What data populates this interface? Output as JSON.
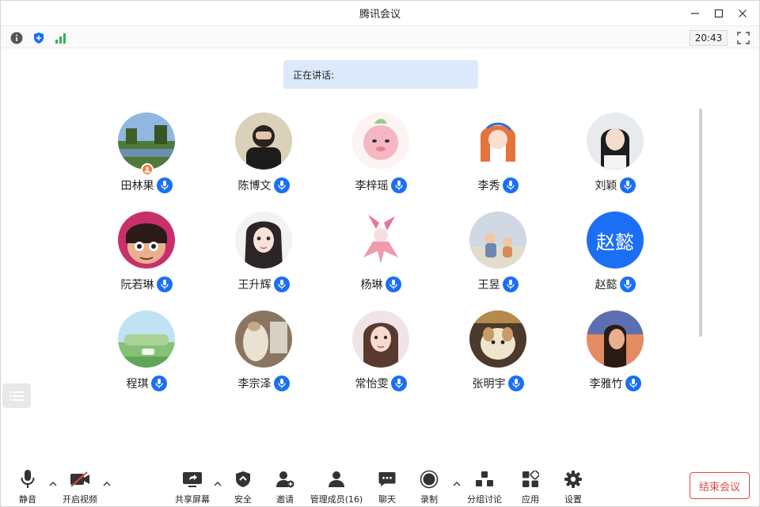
{
  "window": {
    "title": "腾讯会议"
  },
  "infobar": {
    "clock": "20:43"
  },
  "speaking": {
    "label": "正在讲话:"
  },
  "participants": [
    {
      "name": "田林果",
      "host": true
    },
    {
      "name": "陈博文"
    },
    {
      "name": "李梓瑶"
    },
    {
      "name": "李秀"
    },
    {
      "name": "刘颖"
    },
    {
      "name": "阮若琳"
    },
    {
      "name": "王升辉"
    },
    {
      "name": "杨琳"
    },
    {
      "name": "王昱"
    },
    {
      "name": "赵懿",
      "avatar_text": "赵懿"
    },
    {
      "name": "程琪"
    },
    {
      "name": "李宗泽"
    },
    {
      "name": "常怡雯"
    },
    {
      "name": "张明宇"
    },
    {
      "name": "李雅竹"
    }
  ],
  "toolbar": {
    "mute": "静音",
    "video": "开启视频",
    "share": "共享屏幕",
    "security": "安全",
    "invite": "邀请",
    "members": "管理成员(16)",
    "chat": "聊天",
    "record": "录制",
    "breakout": "分组讨论",
    "apps": "应用",
    "settings": "设置",
    "end": "结束会议"
  },
  "colors": {
    "accent": "#1a6ff5",
    "danger": "#e64545",
    "speaking_bg": "#dbe9fb"
  }
}
